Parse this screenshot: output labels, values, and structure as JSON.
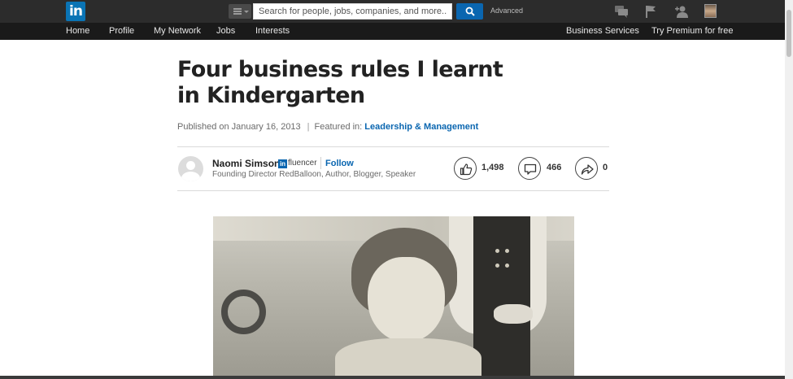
{
  "header": {
    "logo_text": "in",
    "search_placeholder": "Search for people, jobs, companies, and more...",
    "advanced_label": "Advanced",
    "icons": [
      "menu-icon",
      "search-icon",
      "messages-icon",
      "flag-icon",
      "add-connection-icon",
      "profile-avatar"
    ]
  },
  "nav": {
    "left": [
      "Home",
      "Profile",
      "My Network",
      "Jobs",
      "Interests"
    ],
    "right": [
      "Business Services",
      "Try Premium for free"
    ]
  },
  "article": {
    "title": "Four business rules I learnt in Kindergarten",
    "published": "Published on January 16, 2013",
    "separator": "|",
    "featured_prefix": "Featured in:",
    "featured_link": "Leadership & Management",
    "author": {
      "name": "Naomi Simson",
      "badge_text": "in",
      "badge_suffix": "fluencer",
      "follow_label": "Follow",
      "headline": "Founding Director RedBalloon, Author, Blogger, Speaker"
    },
    "stats": {
      "likes": "1,498",
      "comments": "466",
      "shares": "0"
    }
  },
  "colors": {
    "brand_blue": "#0a66b0",
    "topbar": "#2c2c2c",
    "navbar": "#1a1a1a"
  }
}
